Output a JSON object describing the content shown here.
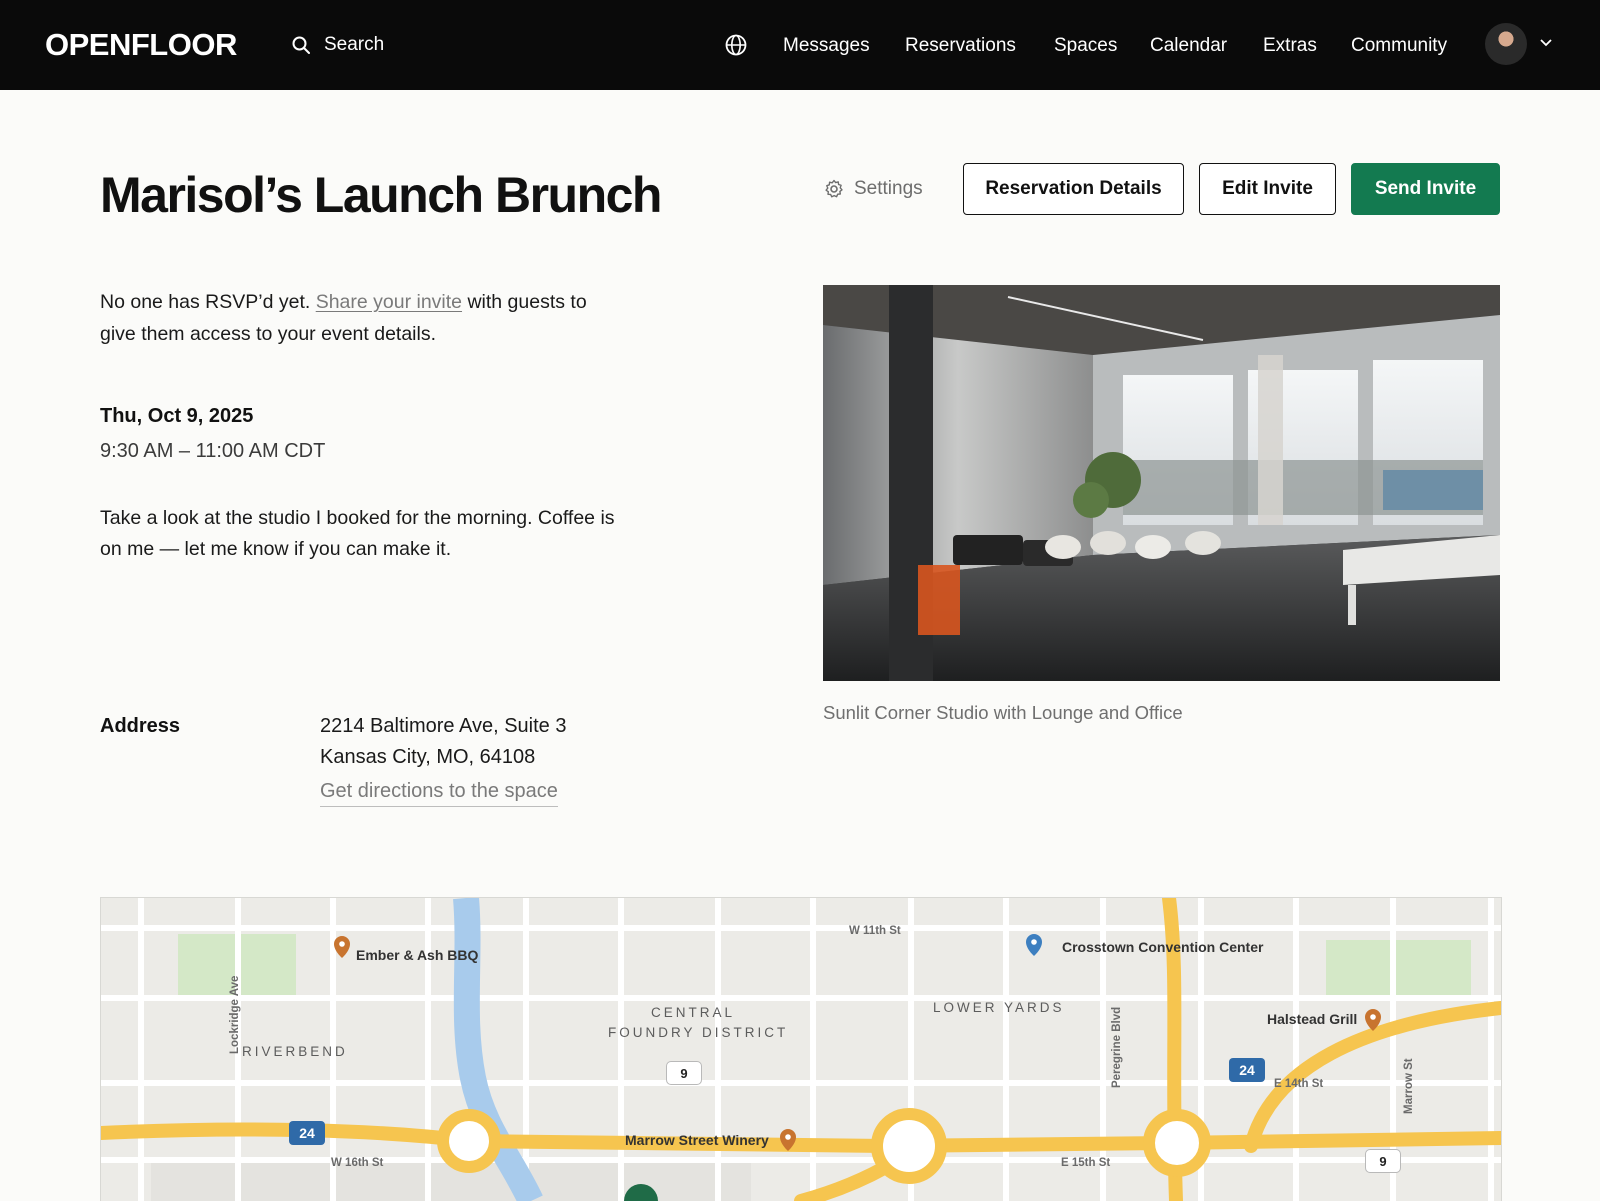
{
  "header": {
    "logo": "OPENFLOOR",
    "search_label": "Search",
    "nav": [
      "Messages",
      "Reservations",
      "Spaces",
      "Calendar",
      "Extras",
      "Community"
    ]
  },
  "event": {
    "title": "Marisol’s Launch Brunch",
    "settings_label": "Settings",
    "reservation_details_label": "Reservation Details",
    "edit_invite_label": "Edit Invite",
    "send_invite_label": "Send Invite",
    "rsvp_before": "No one has RSVP’d yet. ",
    "rsvp_link": "Share your invite",
    "rsvp_after": " with guests to give them access to your event details.",
    "date": "Thu, Oct 9, 2025",
    "time": "9:30 AM – 11:00 AM CDT",
    "note": "Take a look at the studio I booked for the morning. Coffee is on me — let me know if you can make it.",
    "address_label": "Address",
    "address_line1": "2214 Baltimore Ave, Suite 3",
    "address_line2": "Kansas City, MO, 64108",
    "directions_label": "Get directions to the space",
    "photo_caption": "Sunlit Corner Studio with Lounge and Office"
  },
  "map": {
    "pois": [
      "Ember & Ash BBQ",
      "Crosstown Convention Center",
      "Halstead Grill",
      "Marrow Street Winery"
    ],
    "districts": [
      "RIVERBEND",
      "CENTRAL",
      "FOUNDRY DISTRICT",
      "LOWER YARDS"
    ],
    "streets": [
      "W 11th St",
      "W 16th St",
      "E 15th St",
      "E 14th St",
      "Lockridge Ave",
      "Peregrine Blvd",
      "Marrow St"
    ],
    "shields": [
      "24",
      "24",
      "9",
      "9"
    ]
  },
  "colors": {
    "accent": "#137a50",
    "topbar": "#0a0a0a",
    "highway": "#f6c54f",
    "river": "#a8cbec",
    "park": "#d4e8c7"
  }
}
